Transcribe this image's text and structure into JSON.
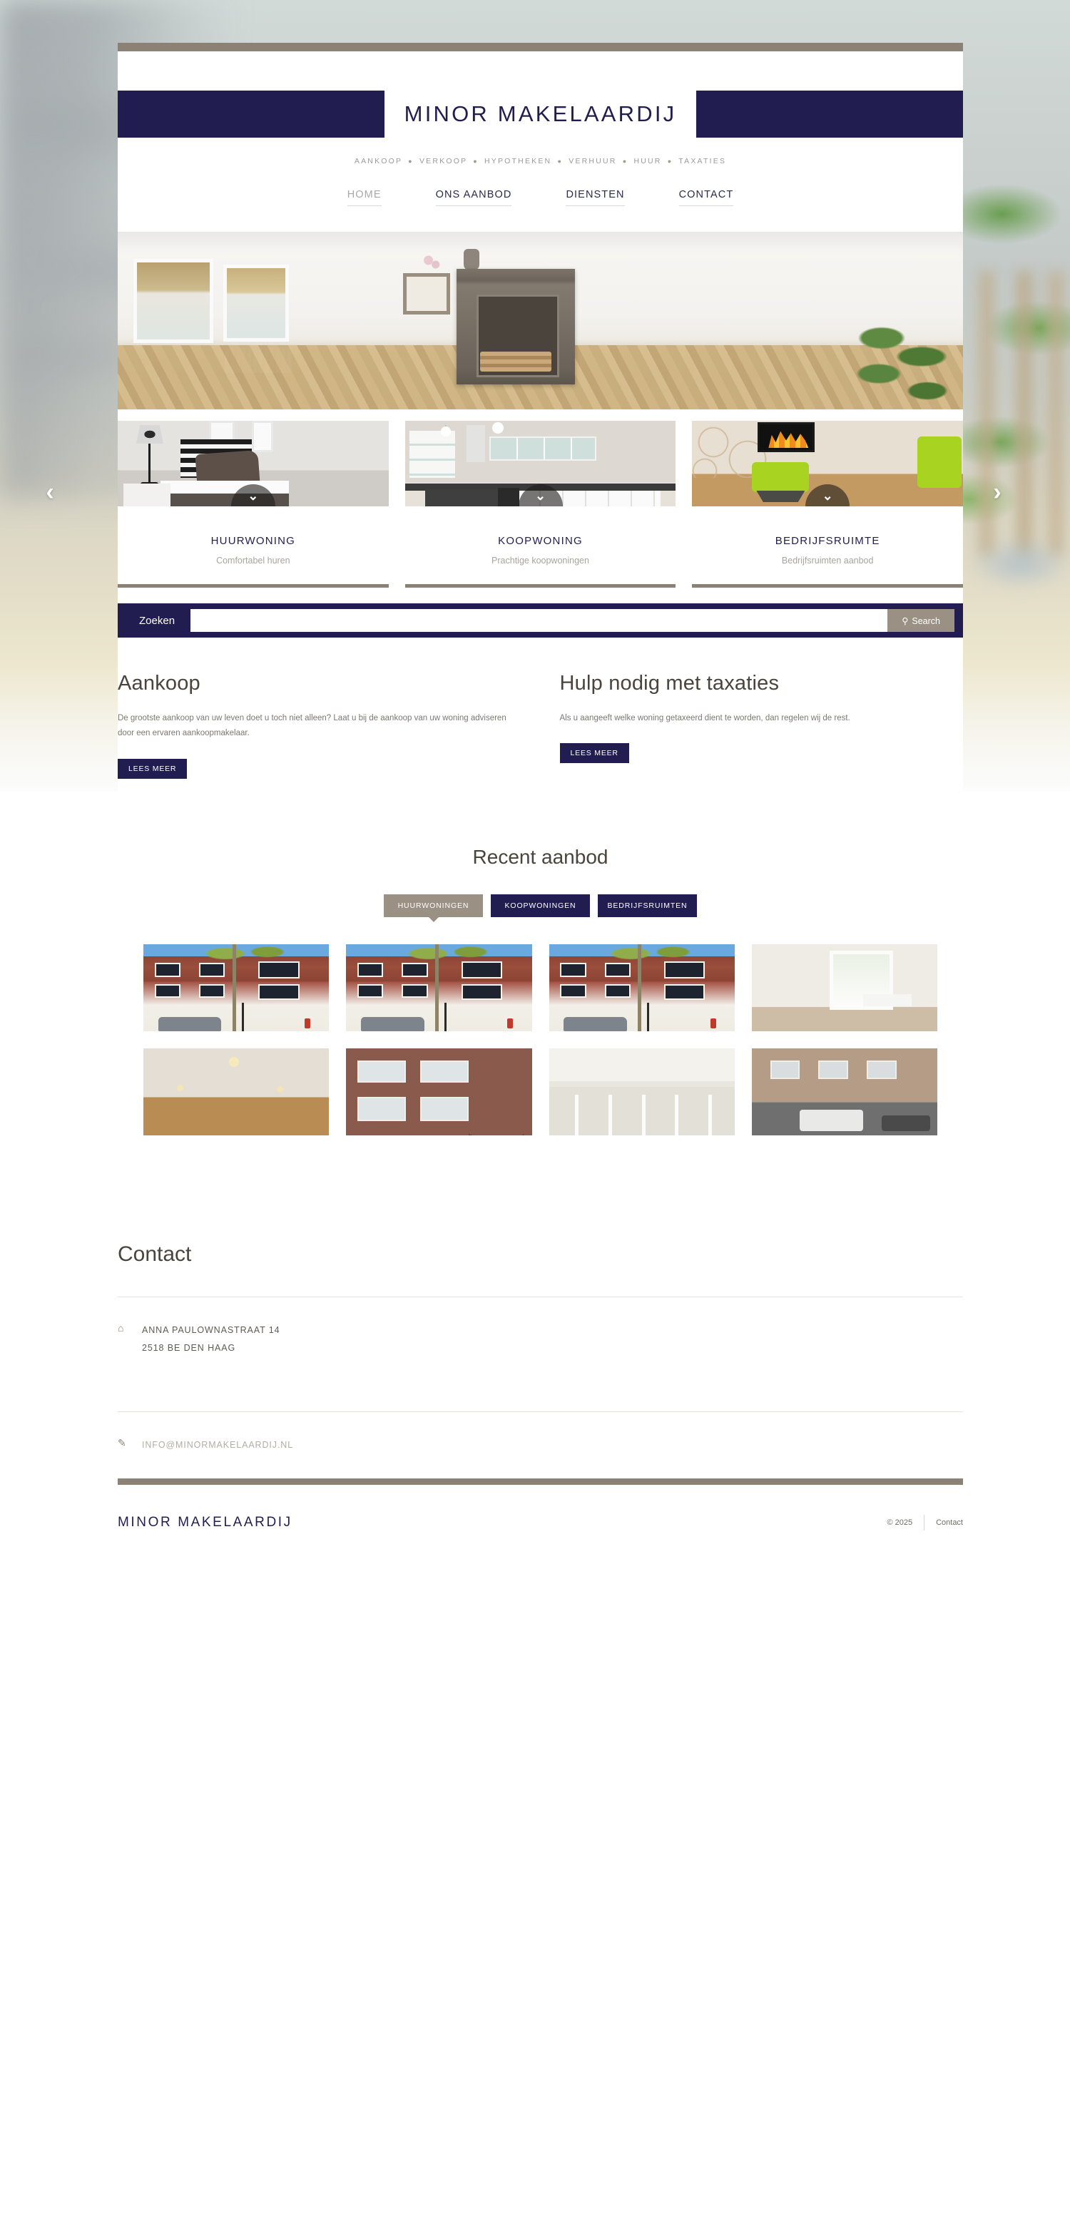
{
  "site": {
    "brand": "MINOR MAKELAARDIJ",
    "tagline_items": [
      "AANKOOP",
      "VERKOOP",
      "HYPOTHEKEN",
      "VERHUUR",
      "HUUR",
      "TAXATIES"
    ],
    "tagline_separator": "●"
  },
  "colors": {
    "navy": "#211d50",
    "khaki": "#8b8275",
    "muted_text": "#a8a49c"
  },
  "nav": {
    "items": [
      {
        "label": "HOME",
        "active": true
      },
      {
        "label": "ONS AANBOD",
        "active": false
      },
      {
        "label": "DIENSTEN",
        "active": false
      },
      {
        "label": "CONTACT",
        "active": false
      }
    ]
  },
  "hero": {
    "prev_icon": "chevron-left",
    "next_icon": "chevron-right",
    "prev_glyph": "‹",
    "next_glyph": "›"
  },
  "categories": [
    {
      "title": "HUURWONING",
      "subtitle": "Comfortabel huren",
      "badge_glyph": "⌄"
    },
    {
      "title": "KOOPWONING",
      "subtitle": "Prachtige koopwoningen",
      "badge_glyph": "⌄"
    },
    {
      "title": "BEDRIJFSRUIMTE",
      "subtitle": "Bedrijfsruimten aanbod",
      "badge_glyph": "⌄"
    }
  ],
  "search": {
    "label": "Zoeken",
    "value": "",
    "placeholder": "",
    "button_label": "Search",
    "button_icon_glyph": "⚲"
  },
  "promos": [
    {
      "title": "Aankoop",
      "body": "De grootste aankoop van uw leven doet u toch niet alleen? Laat u bij de aankoop van uw woning adviseren door een ervaren aankoopmakelaar.",
      "cta": "LEES MEER"
    },
    {
      "title": "Hulp nodig met taxaties",
      "body": "Als u aangeeft welke woning getaxeerd dient te worden, dan regelen wij de rest.",
      "cta": "LEES MEER"
    }
  ],
  "recent": {
    "title": "Recent aanbod",
    "tabs": [
      {
        "label": "HUURWONINGEN",
        "active": true
      },
      {
        "label": "KOOPWONINGEN",
        "active": false
      },
      {
        "label": "BEDRIJFSRUIMTEN",
        "active": false
      }
    ],
    "items_count": 8
  },
  "contact": {
    "title": "Contact",
    "address_icon": "home-icon",
    "address_icon_glyph": "⌂",
    "address_line1": "ANNA PAULOWNASTRAAT 14",
    "address_line2": "2518 BE DEN HAAG",
    "email_icon": "pencil-icon",
    "email_icon_glyph": "✎",
    "email": "INFO@MINORMAKELAARDIJ.NL"
  },
  "footer": {
    "brand": "MINOR MAKELAARDIJ",
    "copyright": "© 2025",
    "link": "Contact"
  }
}
